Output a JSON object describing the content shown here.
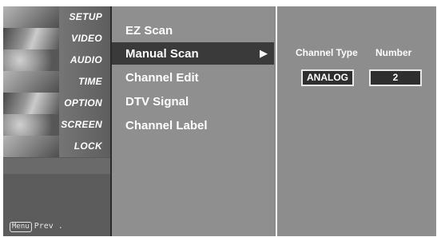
{
  "sidebar": {
    "items": [
      {
        "label": "SETUP",
        "icon": "setup-icon"
      },
      {
        "label": "VIDEO",
        "icon": "video-icon"
      },
      {
        "label": "AUDIO",
        "icon": "audio-icon"
      },
      {
        "label": "TIME",
        "icon": "time-icon"
      },
      {
        "label": "OPTION",
        "icon": "option-icon"
      },
      {
        "label": "SCREEN",
        "icon": "screen-icon"
      },
      {
        "label": "LOCK",
        "icon": "lock-icon"
      }
    ],
    "footer_key": "Menu",
    "footer_text": "Prev ."
  },
  "menu": {
    "items": [
      {
        "label": "EZ Scan"
      },
      {
        "label": "Manual Scan",
        "selected": true,
        "submenu_arrow": "▶"
      },
      {
        "label": "Channel Edit"
      },
      {
        "label": "DTV Signal"
      },
      {
        "label": "Channel Label"
      }
    ]
  },
  "manual_scan": {
    "channel_type_header": "Channel Type",
    "number_header": "Number",
    "channel_type_value": "ANALOG",
    "number_value": "2"
  }
}
